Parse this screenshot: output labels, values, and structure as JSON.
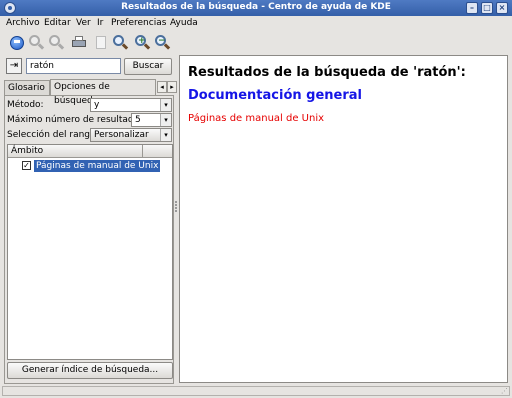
{
  "window": {
    "title": "Resultados de la búsqueda - Centro de ayuda de KDE"
  },
  "menu": [
    {
      "label": "Archivo"
    },
    {
      "label": "Editar"
    },
    {
      "label": "Ver"
    },
    {
      "label": "Ir"
    },
    {
      "label": "Preferencias"
    },
    {
      "label": "Ayuda"
    }
  ],
  "toolbar": {
    "icons": [
      "home-icon",
      "back-icon",
      "forward-icon",
      "print-icon",
      "copy-icon",
      "find-icon",
      "zoom-in-icon",
      "zoom-out-icon"
    ]
  },
  "search": {
    "value": "ratón",
    "button_label": "Buscar"
  },
  "tabs": [
    {
      "label": "Glosario",
      "active": false
    },
    {
      "label": "Opciones de búsqueda",
      "active": true
    }
  ],
  "options": {
    "method_label": "Método:",
    "method_value": "y",
    "max_results_label": "Máximo número de resultados:",
    "max_results_value": "5",
    "range_label": "Selección del rango:",
    "range_value": "Personalizar"
  },
  "scope": {
    "header": "Ámbito",
    "items": [
      {
        "label": "Páginas de manual de Unix",
        "checked": true,
        "selected": true
      }
    ]
  },
  "generate_index_button": "Generar índice de búsqueda...",
  "results": {
    "title": "Resultados de la búsqueda de 'ratón':",
    "section_link": "Documentación general",
    "subsection": "Páginas de manual de Unix"
  },
  "colors": {
    "titlebar": "#345fa8",
    "link": "#1515e6",
    "subsection": "#e60000",
    "selection": "#3162b3"
  }
}
